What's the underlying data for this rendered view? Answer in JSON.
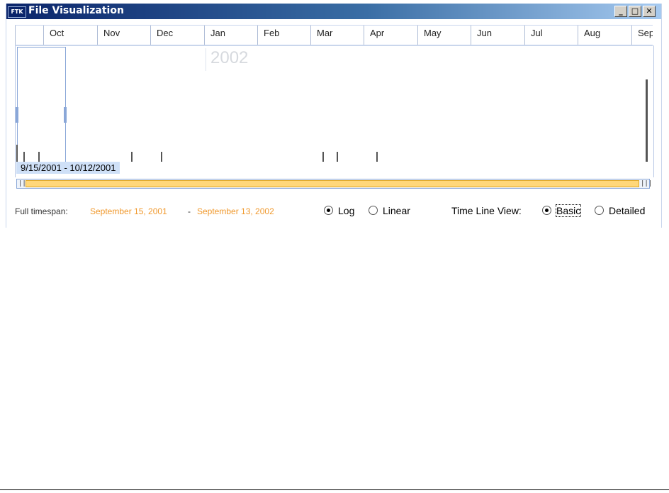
{
  "window": {
    "title": "File Visualization",
    "app_badge": "FTK",
    "controls": {
      "minimize": "_",
      "maximize": "□",
      "close": "✕"
    }
  },
  "timeline": {
    "months": [
      "",
      "Oct",
      "Nov",
      "Dec",
      "Jan",
      "Feb",
      "Mar",
      "Apr",
      "May",
      "Jun",
      "Jul",
      "Aug",
      "Sep"
    ],
    "year_label": "2002",
    "selection_range": "9/15/2001 - 10/12/2001"
  },
  "footer": {
    "full_timespan_label": "Full timespan:",
    "start_date": "September 15, 2001",
    "separator": "-",
    "end_date": "September 13, 2002",
    "scale_options": [
      "Log",
      "Linear"
    ],
    "scale_selected": "Log",
    "view_label": "Time Line View:",
    "view_options": [
      "Basic",
      "Detailed"
    ],
    "view_selected": "Basic"
  },
  "colors": {
    "accent_date": "#f0982b",
    "scrollbar_thumb": "#ffd77a",
    "selection_highlight": "#cfe0f7"
  }
}
